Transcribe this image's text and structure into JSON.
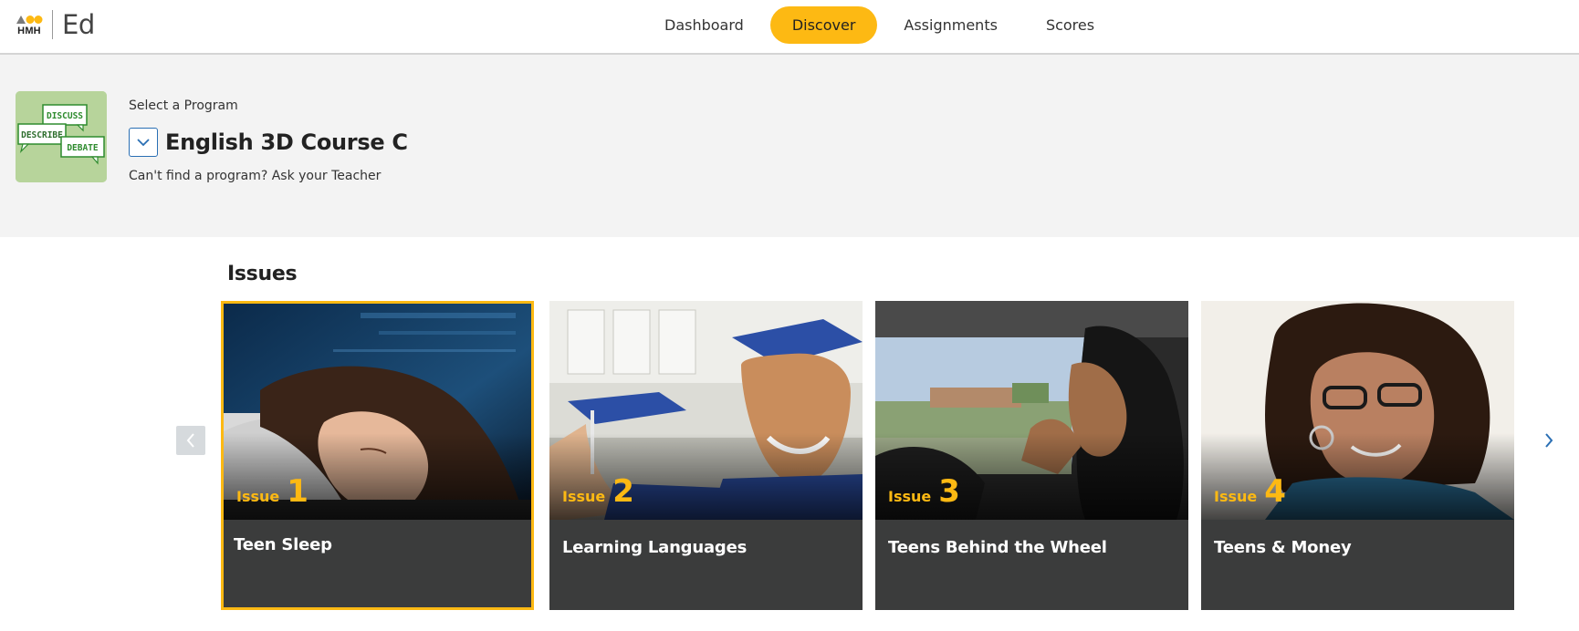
{
  "header": {
    "logo_text": "HMH",
    "app_name": "Ed",
    "nav": [
      {
        "label": "Dashboard",
        "active": false
      },
      {
        "label": "Discover",
        "active": true
      },
      {
        "label": "Assignments",
        "active": false
      },
      {
        "label": "Scores",
        "active": false
      }
    ]
  },
  "program": {
    "select_label": "Select a Program",
    "name": "English 3D Course C",
    "help_text": "Can't find a program? Ask your Teacher",
    "thumbnail_words": [
      "DISCUSS",
      "DESCRIBE",
      "DEBATE"
    ]
  },
  "issues": {
    "heading": "Issues",
    "cards": [
      {
        "issue_word": "Issue",
        "number": "1",
        "title": "Teen Sleep",
        "selected": true
      },
      {
        "issue_word": "Issue",
        "number": "2",
        "title": "Learning Languages",
        "selected": false
      },
      {
        "issue_word": "Issue",
        "number": "3",
        "title": "Teens Behind the Wheel",
        "selected": false
      },
      {
        "issue_word": "Issue",
        "number": "4",
        "title": "Teens & Money",
        "selected": false
      }
    ]
  },
  "colors": {
    "accent": "#fdb913",
    "card_bg": "#3b3c3c",
    "band_bg": "#f3f3f3",
    "link_blue": "#2a6fb4"
  }
}
